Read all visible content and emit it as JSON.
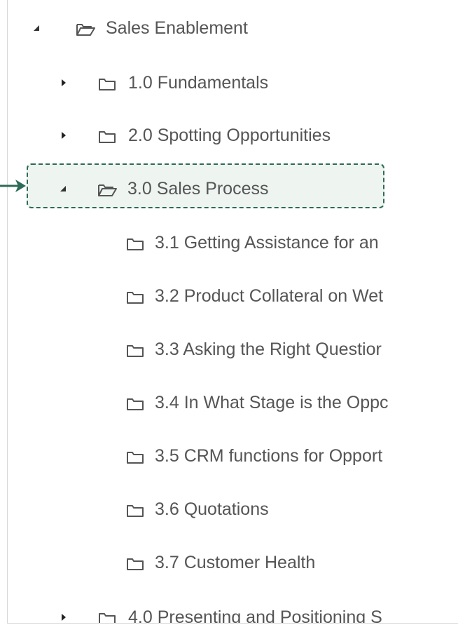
{
  "tree": {
    "root": {
      "label": "Sales Enablement",
      "expanded": true
    },
    "children": [
      {
        "label": "1.0 Fundamentals",
        "expanded": false
      },
      {
        "label": "2.0 Spotting Opportunities",
        "expanded": false
      },
      {
        "label": "3.0 Sales Process",
        "expanded": true,
        "highlighted": true
      },
      {
        "label": "4.0 Presenting and Positioning S",
        "expanded": false
      }
    ],
    "sales_process_children": [
      {
        "label": "3.1 Getting Assistance for an"
      },
      {
        "label": "3.2 Product Collateral on Wet"
      },
      {
        "label": "3.3 Asking the Right Questior"
      },
      {
        "label": "3.4 In What Stage is the Oppc"
      },
      {
        "label": "3.5 CRM functions for Opport"
      },
      {
        "label": "3.6 Quotations"
      },
      {
        "label": "3.7 Customer Health"
      }
    ]
  },
  "colors": {
    "highlight_border": "#2c6b57",
    "highlight_fill": "#eef4f0",
    "text": "#555555",
    "icon": "#555555"
  },
  "icons": {
    "expanded_toggle": "triangle-down-left-icon",
    "collapsed_toggle": "triangle-right-icon",
    "open_folder": "folder-open-icon",
    "closed_folder": "folder-icon",
    "callout_arrow": "arrow-right-icon"
  }
}
